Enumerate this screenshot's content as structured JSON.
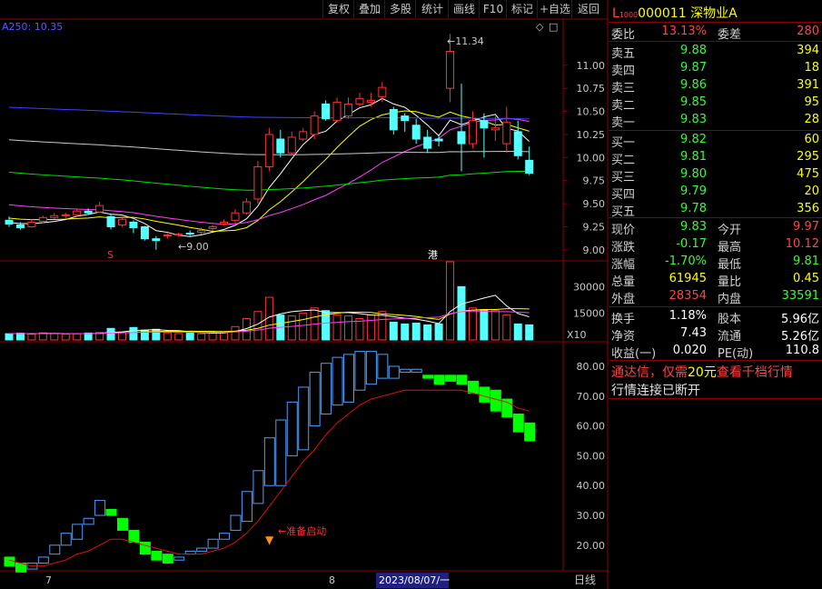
{
  "toolbar": {
    "buttons": [
      "复权",
      "叠加",
      "多股",
      "统计",
      "画线",
      "F10",
      "标记",
      "+自选",
      "返回"
    ]
  },
  "stock": {
    "prefix": "L",
    "market_code": "1000",
    "code": "000011",
    "name": "深物业A"
  },
  "chart": {
    "ma_label": "A250: 10.35",
    "high_annotation": "11.34",
    "low_annotation": "9.00",
    "marker_s": "S",
    "marker_gang": "港",
    "signal_label": "准备启动",
    "volume_multiplier": "X10",
    "price_ticks": [
      "11.00",
      "10.75",
      "10.50",
      "10.25",
      "10.00",
      "9.75",
      "9.50",
      "9.25",
      "9.00"
    ],
    "volume_ticks": [
      "30000",
      "15000"
    ],
    "indicator_ticks": [
      "80.00",
      "70.00",
      "60.00",
      "50.00",
      "40.00",
      "30.00",
      "20.00"
    ],
    "month_labels": [
      "7",
      "8"
    ],
    "date_highlight": "2023/08/07/一",
    "period_label": "日线"
  },
  "quote": {
    "order_ratio_label": "委比",
    "order_ratio": "13.13%",
    "order_diff_label": "委差",
    "order_diff": "280",
    "asks": [
      {
        "label": "卖五",
        "price": "9.88",
        "volume": "394"
      },
      {
        "label": "卖四",
        "price": "9.87",
        "volume": "18"
      },
      {
        "label": "卖三",
        "price": "9.86",
        "volume": "391"
      },
      {
        "label": "卖二",
        "price": "9.85",
        "volume": "95"
      },
      {
        "label": "卖一",
        "price": "9.83",
        "volume": "28"
      }
    ],
    "bids": [
      {
        "label": "买一",
        "price": "9.82",
        "volume": "60"
      },
      {
        "label": "买二",
        "price": "9.81",
        "volume": "295"
      },
      {
        "label": "买三",
        "price": "9.80",
        "volume": "475"
      },
      {
        "label": "买四",
        "price": "9.79",
        "volume": "20"
      },
      {
        "label": "买五",
        "price": "9.78",
        "volume": "356"
      }
    ],
    "stats": [
      {
        "l1": "现价",
        "v1": "9.83",
        "c1": "green",
        "l2": "今开",
        "v2": "9.97",
        "c2": "red"
      },
      {
        "l1": "涨跌",
        "v1": "-0.17",
        "c1": "green",
        "l2": "最高",
        "v2": "10.12",
        "c2": "red"
      },
      {
        "l1": "涨幅",
        "v1": "-1.70%",
        "c1": "green",
        "l2": "最低",
        "v2": "9.81",
        "c2": "green"
      },
      {
        "l1": "总量",
        "v1": "61945",
        "c1": "yellow",
        "l2": "量比",
        "v2": "0.45",
        "c2": "yellow"
      },
      {
        "l1": "外盘",
        "v1": "28354",
        "c1": "red",
        "l2": "内盘",
        "v2": "33591",
        "c2": "green"
      }
    ],
    "stats2": [
      {
        "l1": "换手",
        "v1": "1.18%",
        "l2": "股本",
        "v2": "5.96亿"
      },
      {
        "l1": "净资",
        "v1": "7.43",
        "l2": "流通",
        "v2": "5.26亿"
      },
      {
        "l1": "收益(一)",
        "v1": "0.020",
        "l2": "PE(动)",
        "v2": "110.8"
      }
    ],
    "ad_text_1": "通达信，仅需",
    "ad_text_2": "20元",
    "ad_text_3": "查看千档行情",
    "status_text": "行情连接已断开"
  },
  "candles": [
    {
      "o": 9.32,
      "c": 9.28,
      "h": 9.36,
      "l": 9.25
    },
    {
      "o": 9.27,
      "c": 9.24,
      "h": 9.3,
      "l": 9.22
    },
    {
      "o": 9.25,
      "c": 9.3,
      "h": 9.33,
      "l": 9.24
    },
    {
      "o": 9.31,
      "c": 9.35,
      "h": 9.37,
      "l": 9.29
    },
    {
      "o": 9.35,
      "c": 9.37,
      "h": 9.4,
      "l": 9.33
    },
    {
      "o": 9.37,
      "c": 9.38,
      "h": 9.4,
      "l": 9.34
    },
    {
      "o": 9.38,
      "c": 9.42,
      "h": 9.44,
      "l": 9.36
    },
    {
      "o": 9.42,
      "c": 9.4,
      "h": 9.45,
      "l": 9.38
    },
    {
      "o": 9.41,
      "c": 9.48,
      "h": 9.52,
      "l": 9.4
    },
    {
      "o": 9.36,
      "c": 9.25,
      "h": 9.38,
      "l": 9.22
    },
    {
      "o": 9.27,
      "c": 9.33,
      "h": 9.35,
      "l": 9.25
    },
    {
      "o": 9.3,
      "c": 9.24,
      "h": 9.32,
      "l": 9.18
    },
    {
      "o": 9.25,
      "c": 9.12,
      "h": 9.26,
      "l": 9.1
    },
    {
      "o": 9.12,
      "c": 9.1,
      "h": 9.15,
      "l": 9.0
    },
    {
      "o": 9.15,
      "c": 9.16,
      "h": 9.18,
      "l": 9.12
    },
    {
      "o": 9.16,
      "c": 9.17,
      "h": 9.19,
      "l": 9.14
    },
    {
      "o": 9.18,
      "c": 9.17,
      "h": 9.21,
      "l": 9.15
    },
    {
      "o": 9.19,
      "c": 9.21,
      "h": 9.24,
      "l": 9.17
    },
    {
      "o": 9.23,
      "c": 9.25,
      "h": 9.27,
      "l": 9.2
    },
    {
      "o": 9.28,
      "c": 9.3,
      "h": 9.33,
      "l": 9.26
    },
    {
      "o": 9.32,
      "c": 9.4,
      "h": 9.44,
      "l": 9.28
    },
    {
      "o": 9.4,
      "c": 9.52,
      "h": 9.56,
      "l": 9.38
    },
    {
      "o": 9.55,
      "c": 9.9,
      "h": 9.96,
      "l": 9.5
    },
    {
      "o": 9.9,
      "c": 10.25,
      "h": 10.32,
      "l": 9.85
    },
    {
      "o": 10.2,
      "c": 10.05,
      "h": 10.3,
      "l": 10.0
    },
    {
      "o": 10.05,
      "c": 10.22,
      "h": 10.28,
      "l": 10.02
    },
    {
      "o": 10.2,
      "c": 10.28,
      "h": 10.32,
      "l": 10.18
    },
    {
      "o": 10.25,
      "c": 10.45,
      "h": 10.5,
      "l": 10.2
    },
    {
      "o": 10.58,
      "c": 10.42,
      "h": 10.62,
      "l": 10.4
    },
    {
      "o": 10.4,
      "c": 10.6,
      "h": 10.65,
      "l": 10.38
    },
    {
      "o": 10.45,
      "c": 10.58,
      "h": 10.65,
      "l": 10.42
    },
    {
      "o": 10.58,
      "c": 10.64,
      "h": 10.7,
      "l": 10.55
    },
    {
      "o": 10.6,
      "c": 10.62,
      "h": 10.7,
      "l": 10.55
    },
    {
      "o": 10.66,
      "c": 10.76,
      "h": 10.82,
      "l": 10.6
    },
    {
      "o": 10.52,
      "c": 10.3,
      "h": 10.55,
      "l": 10.25
    },
    {
      "o": 10.45,
      "c": 10.4,
      "h": 10.48,
      "l": 10.28
    },
    {
      "o": 10.35,
      "c": 10.2,
      "h": 10.42,
      "l": 10.15
    },
    {
      "o": 10.22,
      "c": 10.1,
      "h": 10.3,
      "l": 10.05
    },
    {
      "o": 10.2,
      "c": 10.18,
      "h": 10.25,
      "l": 10.12
    },
    {
      "o": 10.75,
      "c": 11.15,
      "h": 11.34,
      "l": 10.6
    },
    {
      "o": 10.28,
      "c": 10.15,
      "h": 10.8,
      "l": 9.85
    },
    {
      "o": 10.15,
      "c": 10.4,
      "h": 10.5,
      "l": 10.1
    },
    {
      "o": 10.4,
      "c": 10.32,
      "h": 10.48,
      "l": 10.0
    },
    {
      "o": 10.3,
      "c": 10.32,
      "h": 10.45,
      "l": 10.18
    },
    {
      "o": 10.15,
      "c": 10.38,
      "h": 10.55,
      "l": 10.05
    },
    {
      "o": 10.28,
      "c": 10.02,
      "h": 10.4,
      "l": 9.98
    },
    {
      "o": 9.97,
      "c": 9.83,
      "h": 10.12,
      "l": 9.81
    }
  ],
  "ma_series": {
    "ma5": {
      "color": "#ffffff"
    },
    "ma10": {
      "color": "#ffff00"
    },
    "ma20": {
      "color": "#ff40ff"
    },
    "ma60": {
      "color": "#00e000"
    },
    "ma120": {
      "color": "#c8c8c8"
    },
    "ma250": {
      "color": "#4040ff"
    }
  },
  "volumes": [
    3500,
    3800,
    3200,
    4000,
    3600,
    3300,
    3500,
    3900,
    4200,
    6500,
    4500,
    7000,
    5500,
    6000,
    4000,
    3600,
    3800,
    3500,
    4200,
    4800,
    7500,
    12000,
    16000,
    24000,
    14000,
    13500,
    15000,
    18000,
    16500,
    14000,
    13500,
    12000,
    14000,
    16000,
    10000,
    9000,
    9500,
    8500,
    9000,
    44000,
    30000,
    18000,
    17000,
    16500,
    14000,
    9000,
    8500
  ],
  "indicator": [
    {
      "o": 16,
      "c": 13
    },
    {
      "o": 14,
      "c": 11
    },
    {
      "o": 12,
      "c": 14
    },
    {
      "o": 14,
      "c": 16
    },
    {
      "o": 17,
      "c": 20
    },
    {
      "o": 20,
      "c": 24
    },
    {
      "o": 22,
      "c": 27
    },
    {
      "o": 27,
      "c": 29
    },
    {
      "o": 30,
      "c": 35
    },
    {
      "o": 32,
      "c": 30
    },
    {
      "o": 29,
      "c": 25
    },
    {
      "o": 25,
      "c": 21
    },
    {
      "o": 21,
      "c": 17
    },
    {
      "o": 18,
      "c": 15
    },
    {
      "o": 17,
      "c": 14
    },
    {
      "o": 15,
      "c": 16
    },
    {
      "o": 17,
      "c": 18
    },
    {
      "o": 18,
      "c": 19
    },
    {
      "o": 19,
      "c": 22
    },
    {
      "o": 22,
      "c": 24
    },
    {
      "o": 25,
      "c": 30
    },
    {
      "o": 28,
      "c": 38
    },
    {
      "o": 34,
      "c": 45
    },
    {
      "o": 40,
      "c": 56
    },
    {
      "o": 40,
      "c": 62
    },
    {
      "o": 50,
      "c": 68
    },
    {
      "o": 52,
      "c": 73
    },
    {
      "o": 60,
      "c": 78
    },
    {
      "o": 64,
      "c": 81
    },
    {
      "o": 67,
      "c": 83
    },
    {
      "o": 68,
      "c": 84
    },
    {
      "o": 72,
      "c": 85
    },
    {
      "o": 74,
      "c": 85
    },
    {
      "o": 76,
      "c": 84
    },
    {
      "o": 76,
      "c": 80
    },
    {
      "o": 78,
      "c": 79
    },
    {
      "o": 78,
      "c": 79
    },
    {
      "o": 77,
      "c": 76
    },
    {
      "o": 77,
      "c": 74
    },
    {
      "o": 77,
      "c": 75
    },
    {
      "o": 77,
      "c": 74
    },
    {
      "o": 75,
      "c": 71
    },
    {
      "o": 73,
      "c": 68
    },
    {
      "o": 72,
      "c": 65
    },
    {
      "o": 69,
      "c": 63
    },
    {
      "o": 64,
      "c": 58
    },
    {
      "o": 61,
      "c": 55
    }
  ],
  "indicator_line": [
    15,
    14,
    13,
    13,
    14,
    15,
    17,
    18,
    20,
    22,
    22,
    21,
    20,
    19,
    18,
    17,
    17,
    17,
    18,
    19,
    21,
    24,
    28,
    33,
    38,
    43,
    48,
    52,
    57,
    61,
    64,
    67,
    69,
    70,
    71,
    72,
    72,
    72,
    72,
    72,
    72,
    71,
    70,
    69,
    68,
    66,
    65
  ],
  "colors": {
    "up": "#ff3232",
    "down": "#54ffff",
    "green": "#00ff00",
    "border": "#8a0000",
    "axis": "#c8c8c8",
    "label_red": "#ff3232"
  }
}
